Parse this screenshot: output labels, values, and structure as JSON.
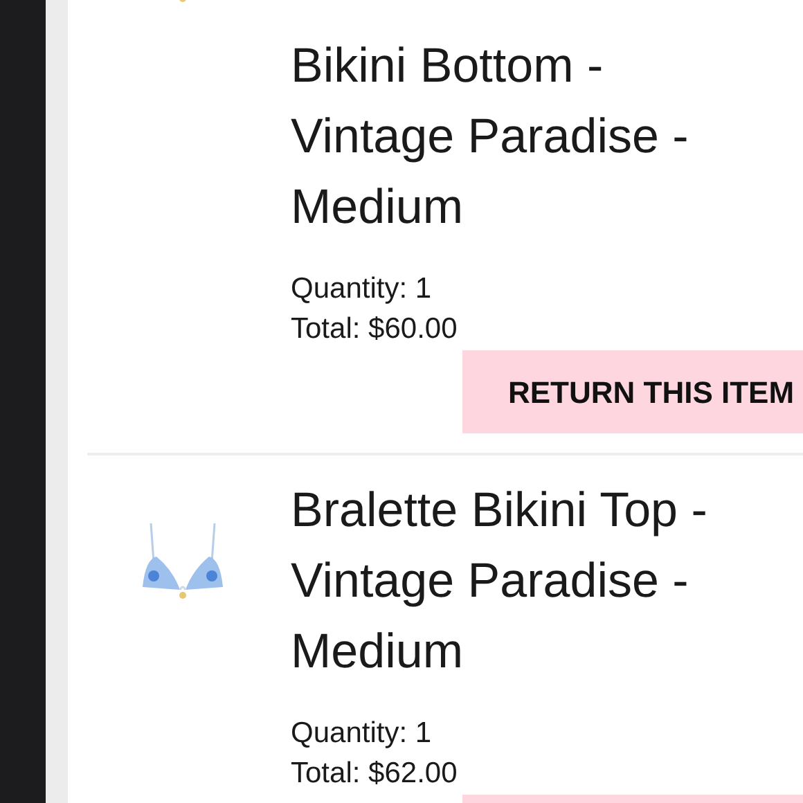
{
  "items": [
    {
      "title": "Bikini Bottom - Vintage Paradise - Medium",
      "quantity": "Quantity: 1",
      "total": "Total: $60.00",
      "has_return_button": true,
      "return_label": "RETURN THIS ITEM"
    },
    {
      "title": "Bralette Bikini Top - Vintage Paradise - Medium",
      "quantity": "Quantity: 1",
      "total": "Total: $62.00",
      "has_return_button": true
    }
  ]
}
